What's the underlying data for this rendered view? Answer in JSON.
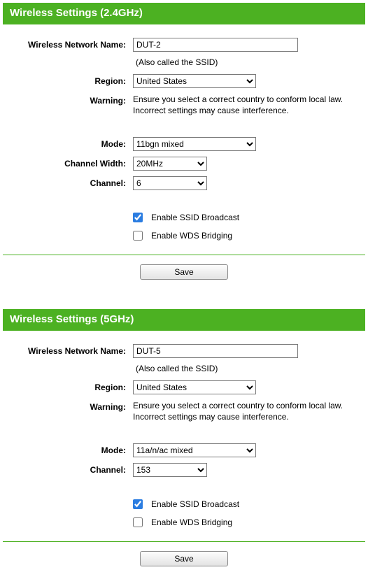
{
  "s24": {
    "header": "Wireless Settings (2.4GHz)",
    "name_label": "Wireless Network Name:",
    "name_value": "DUT-2",
    "ssid_note": "(Also called the SSID)",
    "region_label": "Region:",
    "region_value": "United States",
    "warning_label": "Warning:",
    "warning_text": "Ensure you select a correct country to conform local law. Incorrect settings may cause interference.",
    "mode_label": "Mode:",
    "mode_value": "11bgn mixed",
    "chwidth_label": "Channel Width:",
    "chwidth_value": "20MHz",
    "channel_label": "Channel:",
    "channel_value": "6",
    "ssid_broadcast_label": "Enable SSID Broadcast",
    "ssid_broadcast_checked": true,
    "wds_label": "Enable WDS Bridging",
    "wds_checked": false,
    "save_label": "Save"
  },
  "s5": {
    "header": "Wireless Settings (5GHz)",
    "name_label": "Wireless Network Name:",
    "name_value": "DUT-5",
    "ssid_note": "(Also called the SSID)",
    "region_label": "Region:",
    "region_value": "United States",
    "warning_label": "Warning:",
    "warning_text": "Ensure you select a correct country to conform local law. Incorrect settings may cause interference.",
    "mode_label": "Mode:",
    "mode_value": "11a/n/ac mixed",
    "channel_label": "Channel:",
    "channel_value": "153",
    "ssid_broadcast_label": "Enable SSID Broadcast",
    "ssid_broadcast_checked": true,
    "wds_label": "Enable WDS Bridging",
    "wds_checked": false,
    "save_label": "Save"
  }
}
